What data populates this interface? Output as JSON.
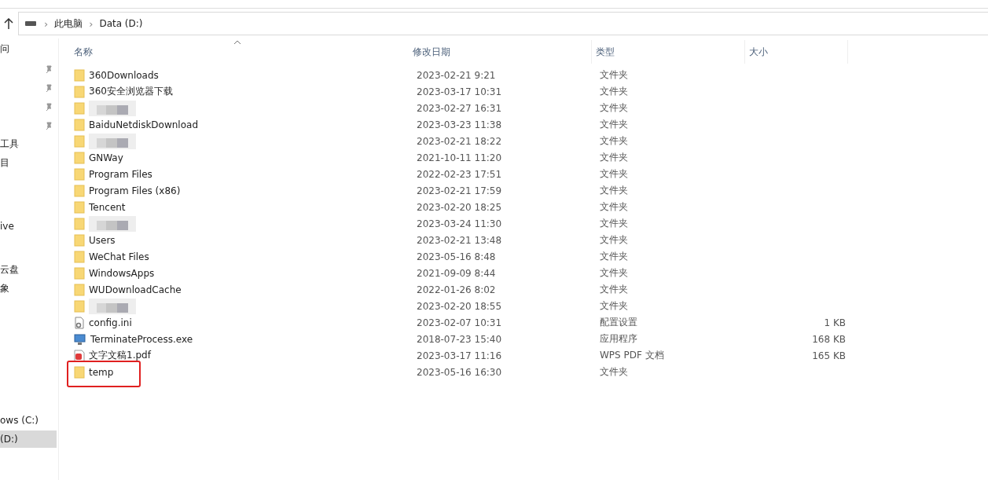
{
  "address_bar": {
    "crumbs": [
      {
        "separator": "›",
        "label": "此电脑"
      },
      {
        "separator": "›",
        "label": "Data (D:)"
      }
    ]
  },
  "nav_pane": {
    "items": [
      {
        "label": "问",
        "pinned": false,
        "selected": false
      },
      {
        "pinned": true,
        "selected": false
      },
      {
        "pinned": true,
        "selected": false
      },
      {
        "pinned": true,
        "selected": false
      },
      {
        "pinned": true,
        "selected": false
      },
      {
        "label": "工具",
        "pinned": false,
        "selected": false
      },
      {
        "label": "目",
        "pinned": false,
        "selected": false
      },
      {
        "label": "ive",
        "pinned": false,
        "selected": false
      },
      {
        "label": "云盘",
        "pinned": false,
        "selected": false
      },
      {
        "label": "象",
        "pinned": false,
        "selected": false
      },
      {
        "label": "ows (C:)",
        "pinned": false,
        "selected": false
      },
      {
        "label": "(D:)",
        "pinned": false,
        "selected": true
      }
    ]
  },
  "table": {
    "columns": [
      {
        "label": "名称",
        "sorted": true
      },
      {
        "label": "修改日期",
        "sorted": false
      },
      {
        "label": "类型",
        "sorted": false
      },
      {
        "label": "大小",
        "sorted": false
      }
    ],
    "rows": [
      {
        "kind": "folder",
        "name": "360Downloads",
        "date": "2023-02-21 9:21",
        "type": "文件夹",
        "redacted": false,
        "highlighted": false
      },
      {
        "kind": "folder",
        "name": "360安全浏览器下载",
        "date": "2023-03-17 10:31",
        "type": "文件夹",
        "redacted": false,
        "highlighted": false
      },
      {
        "kind": "folder",
        "date": "2023-02-27 16:31",
        "type": "文件夹",
        "redacted": true,
        "highlighted": false
      },
      {
        "kind": "folder",
        "name": "BaiduNetdiskDownload",
        "date": "2023-03-23 11:38",
        "type": "文件夹",
        "redacted": false,
        "highlighted": false
      },
      {
        "kind": "folder",
        "date": "2023-02-21 18:22",
        "type": "文件夹",
        "redacted": true,
        "highlighted": false
      },
      {
        "kind": "folder",
        "name": "GNWay",
        "date": "2021-10-11 11:20",
        "type": "文件夹",
        "redacted": false,
        "highlighted": false
      },
      {
        "kind": "folder",
        "name": "Program Files",
        "date": "2022-02-23 17:51",
        "type": "文件夹",
        "redacted": false,
        "highlighted": false
      },
      {
        "kind": "folder",
        "name": "Program Files (x86)",
        "date": "2023-02-21 17:59",
        "type": "文件夹",
        "redacted": false,
        "highlighted": false
      },
      {
        "kind": "folder",
        "name": "Tencent",
        "date": "2023-02-20 18:25",
        "type": "文件夹",
        "redacted": false,
        "highlighted": false
      },
      {
        "kind": "folder",
        "date": "2023-03-24 11:30",
        "type": "文件夹",
        "redacted": true,
        "highlighted": false
      },
      {
        "kind": "folder",
        "name": "Users",
        "date": "2023-02-21 13:48",
        "type": "文件夹",
        "redacted": false,
        "highlighted": false
      },
      {
        "kind": "folder",
        "name": "WeChat Files",
        "date": "2023-05-16 8:48",
        "type": "文件夹",
        "redacted": false,
        "highlighted": false
      },
      {
        "kind": "folder",
        "name": "WindowsApps",
        "date": "2021-09-09 8:44",
        "type": "文件夹",
        "redacted": false,
        "highlighted": false
      },
      {
        "kind": "folder",
        "name": "WUDownloadCache",
        "date": "2022-01-26 8:02",
        "type": "文件夹",
        "redacted": false,
        "highlighted": false
      },
      {
        "kind": "folder",
        "date": "2023-02-20 18:55",
        "type": "文件夹",
        "redacted": true,
        "highlighted": false
      },
      {
        "kind": "config",
        "name": "config.ini",
        "date": "2023-02-07 10:31",
        "type": "配置设置",
        "size": "1 KB",
        "redacted": false,
        "highlighted": false
      },
      {
        "kind": "exe",
        "name": "TerminateProcess.exe",
        "date": "2018-07-23 15:40",
        "type": "应用程序",
        "size": "168 KB",
        "redacted": false,
        "highlighted": false
      },
      {
        "kind": "pdf",
        "name": "文字文稿1.pdf",
        "date": "2023-03-17 11:16",
        "type": "WPS PDF 文档",
        "size": "165 KB",
        "redacted": false,
        "highlighted": false
      },
      {
        "kind": "folder",
        "name": "temp",
        "date": "2023-05-16 16:30",
        "type": "文件夹",
        "redacted": false,
        "highlighted": true
      }
    ]
  }
}
